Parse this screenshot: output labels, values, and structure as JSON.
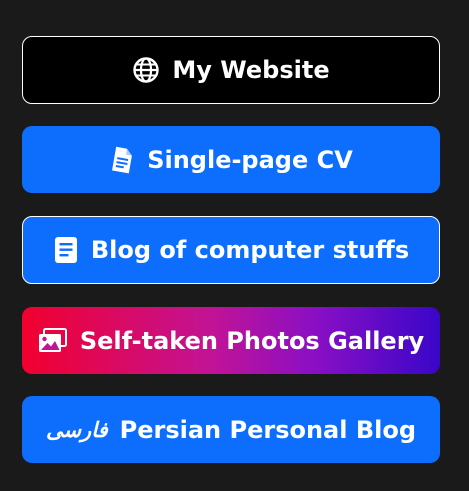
{
  "links": [
    {
      "label": "My Website",
      "icon": "globe-icon"
    },
    {
      "label": "Single-page CV",
      "icon": "document-icon"
    },
    {
      "label": "Blog of computer stuffs",
      "icon": "file-text-icon"
    },
    {
      "label": "Self-taken Photos Gallery",
      "icon": "images-icon"
    },
    {
      "label": "Persian Personal Blog",
      "icon": "persian-script-icon",
      "icon_text": "فارسی"
    }
  ],
  "colors": {
    "background": "#1a1a1a",
    "primary_blue": "#0d6efd",
    "dark_button": "#000000",
    "gradient_start": "#f2002e",
    "gradient_end": "#3a06c8",
    "text": "#ffffff"
  }
}
